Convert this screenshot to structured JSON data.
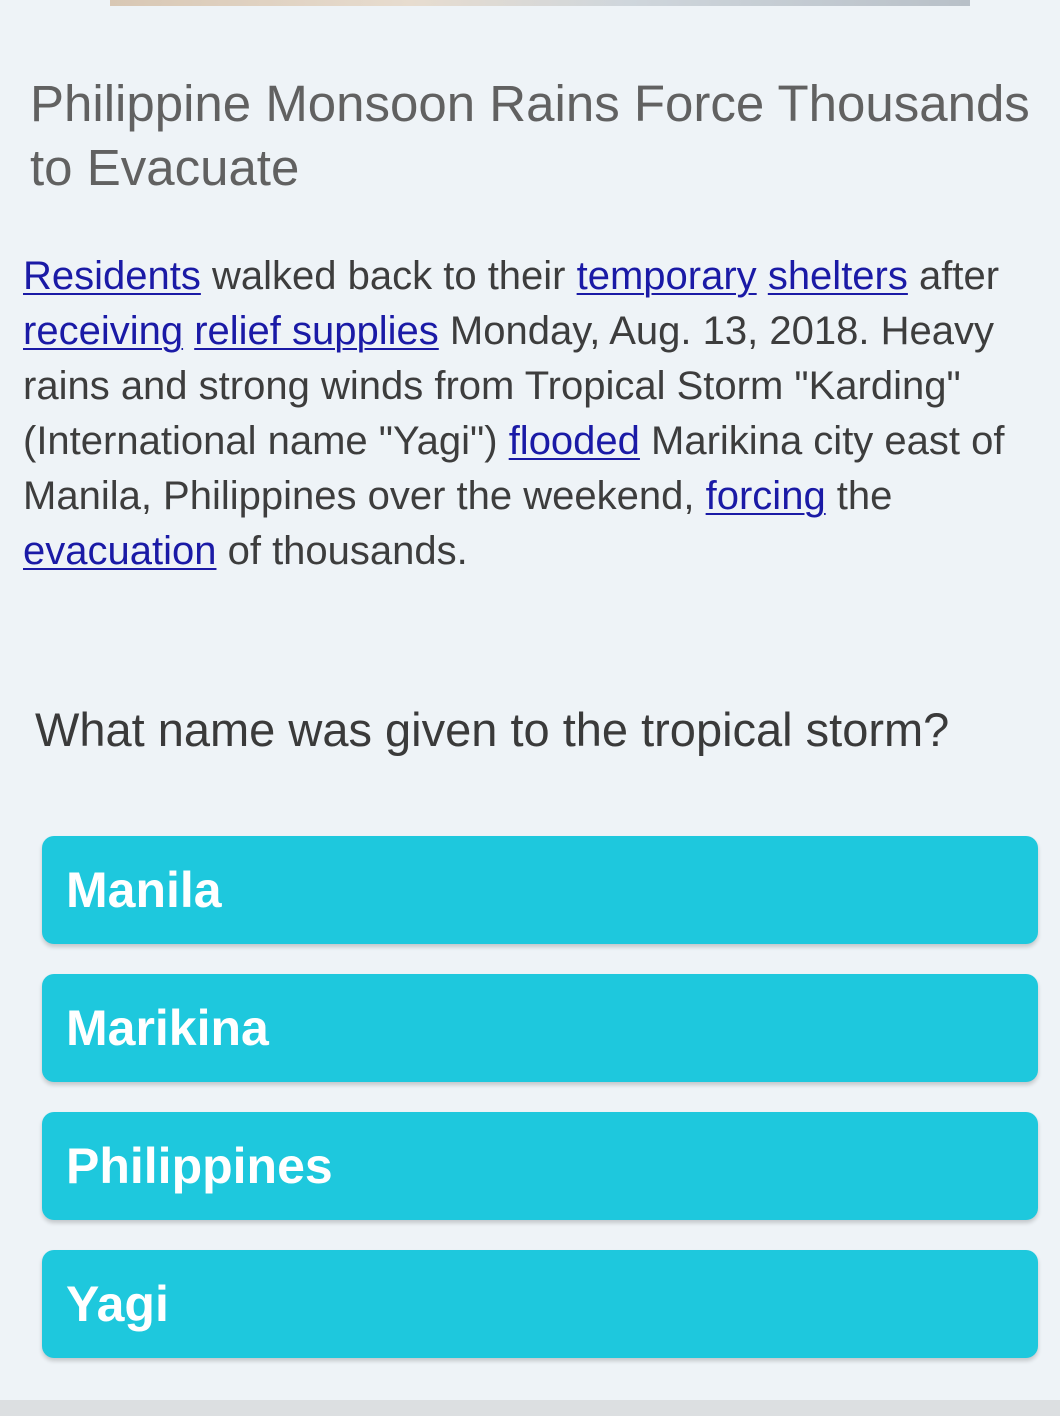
{
  "article": {
    "headline": "Philippine Monsoon Rains Force Thousands to Evacuate",
    "caption": {
      "t0": "Residents",
      "t1": " walked back to their ",
      "t2": "temporary",
      "t3": " ",
      "t4": "shelters",
      "t5": " after ",
      "t6": "receiving",
      "t7": " ",
      "t8": "relief supplies",
      "t9": " Monday, Aug. 13, 2018. Heavy rains and strong winds from Tropical Storm \"Karding\" (International name \"Yagi\") ",
      "t10": "flooded",
      "t11": " Marikina city east of Manila, Philippines over the weekend, ",
      "t12": "forcing",
      "t13": " the ",
      "t14": "evacuation",
      "t15": " of thousands."
    }
  },
  "quiz": {
    "question": "What name was given to the tropical storm?",
    "options": [
      {
        "label": "Manila"
      },
      {
        "label": "Marikina"
      },
      {
        "label": "Philippines"
      },
      {
        "label": "Yagi"
      }
    ]
  },
  "colors": {
    "background": "#eef3f7",
    "option_button": "#1ec8dd",
    "link": "#1a1aa6",
    "headline": "#616161"
  }
}
